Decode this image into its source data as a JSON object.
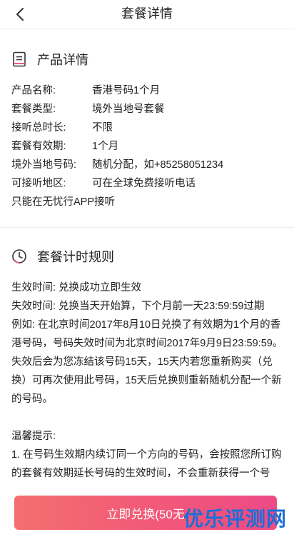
{
  "header": {
    "title": "套餐详情",
    "back_icon": "chevron-left-icon"
  },
  "detail": {
    "section_title": "产品详情",
    "icon": "document-icon",
    "rows": [
      {
        "label": "产品名称:",
        "value": "香港号码1个月"
      },
      {
        "label": "套餐类型:",
        "value": "境外当地号套餐"
      },
      {
        "label": "接听总时长:",
        "value": "不限"
      },
      {
        "label": "套餐有效期:",
        "value": "1个月"
      },
      {
        "label": "境外当地号码:",
        "value": "随机分配，如+85258051234"
      },
      {
        "label": "可接听地区:",
        "value": "可在全球免费接听电话"
      }
    ],
    "note": "只能在无忧行APP接听"
  },
  "rules": {
    "section_title": "套餐计时规则",
    "icon": "clock-icon",
    "lines": [
      "生效时间: 兑换成功立即生效",
      "失效时间: 兑换当天开始算，下个月前一天23:59:59过期",
      "例如: 在北京时间2017年8月10日兑换了有效期为1个月的香港号码，号码失效时间为北京时间2017年9月9日23:59:59。",
      "失效后会为您冻结该号码15天，15天内若您重新购买（兑换）可再次使用此号码，15天后兑换则重新随机分配一个新的号码。"
    ],
    "tips_title": "温馨提示:",
    "tips": [
      "1. 在号码生效期内续订同一个方向的号码，会按照您所订购的套餐有效期延长号码的生效时间，不会重新获得一个号"
    ]
  },
  "footer": {
    "button_label": "立即兑换(50无",
    "watermark": "优乐评测网"
  },
  "colors": {
    "accent_start": "#f36f6f",
    "accent_end": "#ee4a86",
    "watermark": "#1a6fd6"
  }
}
